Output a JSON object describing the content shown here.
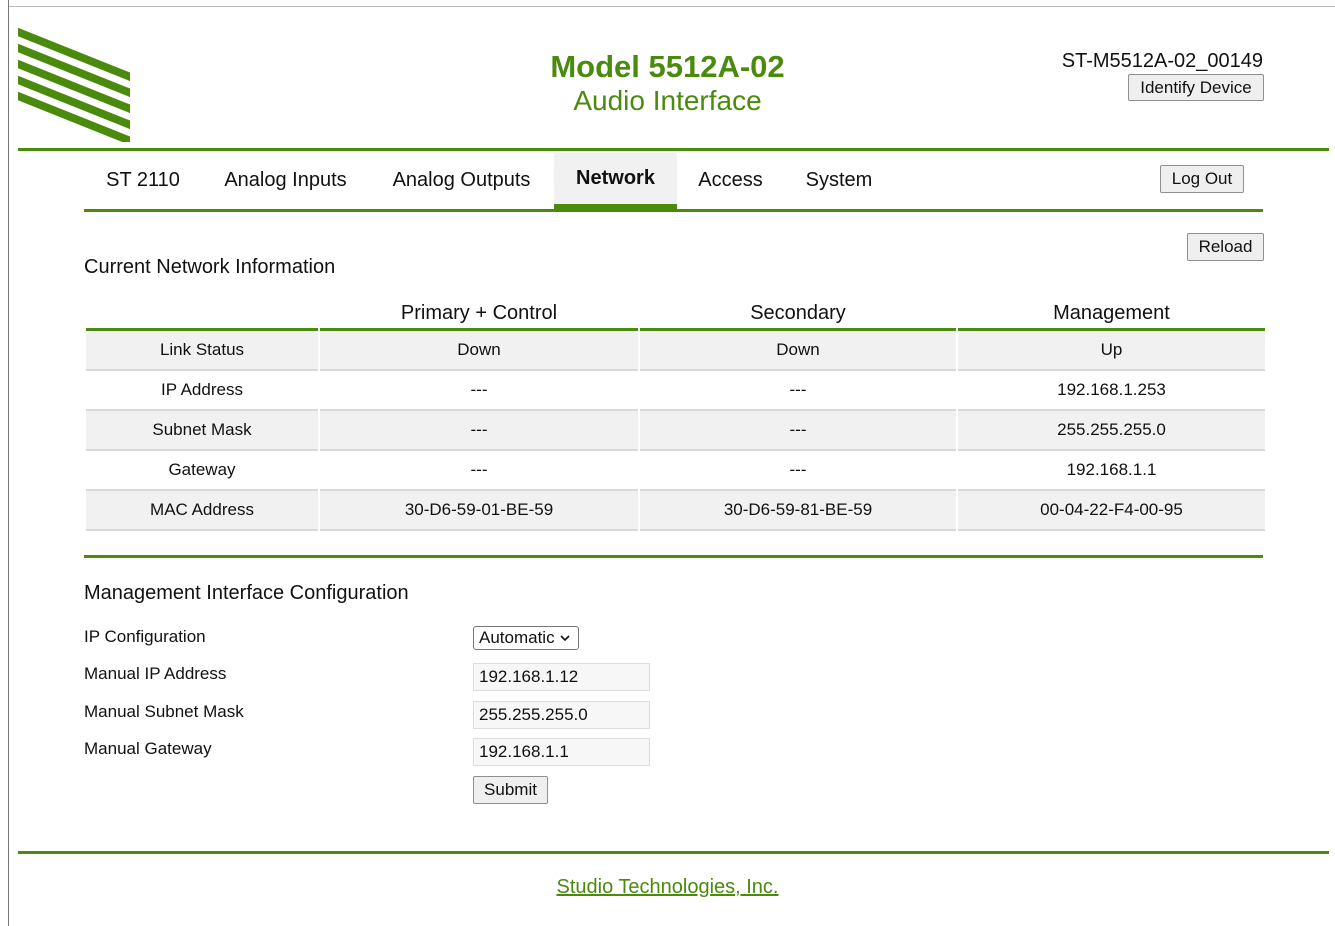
{
  "header": {
    "title_line1": "Model 5512A-02",
    "title_line2": "Audio Interface",
    "device_id": "ST-M5512A-02_00149",
    "identify_label": "Identify Device",
    "brand_color": "#4a8a0c"
  },
  "nav": {
    "tabs": [
      {
        "label": "ST 2110",
        "active": false
      },
      {
        "label": "Analog Inputs",
        "active": false
      },
      {
        "label": "Analog Outputs",
        "active": false
      },
      {
        "label": "Network",
        "active": true
      },
      {
        "label": "Access",
        "active": false
      },
      {
        "label": "System",
        "active": false
      }
    ],
    "logout_label": "Log Out"
  },
  "network_info": {
    "title": "Current Network Information",
    "reload_label": "Reload",
    "columns": [
      "",
      "Primary + Control",
      "Secondary",
      "Management"
    ],
    "rows": [
      [
        "Link Status",
        "Down",
        "Down",
        "Up"
      ],
      [
        "IP Address",
        "---",
        "---",
        "192.168.1.253"
      ],
      [
        "Subnet Mask",
        "---",
        "---",
        "255.255.255.0"
      ],
      [
        "Gateway",
        "---",
        "---",
        "192.168.1.1"
      ],
      [
        "MAC Address",
        "30-D6-59-01-BE-59",
        "30-D6-59-81-BE-59",
        "00-04-22-F4-00-95"
      ]
    ]
  },
  "mgmt_config": {
    "title": "Management Interface Configuration",
    "ip_config_label": "IP Configuration",
    "ip_config_value": "Automatic",
    "manual_ip_label": "Manual IP Address",
    "manual_ip_value": "192.168.1.12",
    "manual_mask_label": "Manual Subnet Mask",
    "manual_mask_value": "255.255.255.0",
    "manual_gateway_label": "Manual Gateway",
    "manual_gateway_value": "192.168.1.1",
    "submit_label": "Submit"
  },
  "footer": {
    "link_text": "Studio Technologies, Inc."
  }
}
